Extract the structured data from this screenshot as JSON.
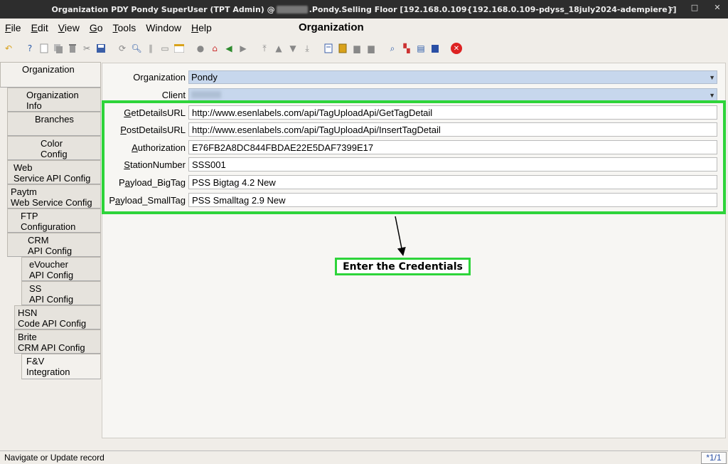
{
  "window": {
    "title_prefix": "Organization  PDY  Pondy  SuperUser (TPT Admin) @ ",
    "title_suffix": ".Pondy.Selling Floor [192.168.0.109{192.168.0.109-pdyss_18july2024-adempiere}]",
    "minimize": "–",
    "maximize": "□",
    "close": "✕"
  },
  "menu": {
    "items": [
      {
        "u": "F",
        "rest": "ile"
      },
      {
        "u": "E",
        "rest": "dit"
      },
      {
        "u": "V",
        "rest": "iew"
      },
      {
        "u": "G",
        "rest": "o"
      },
      {
        "u": "T",
        "rest": "ools"
      },
      {
        "u": "",
        "rest": "Window"
      },
      {
        "u": "H",
        "rest": "elp"
      }
    ],
    "window_title": "Organization"
  },
  "tabs": [
    {
      "line1": "Organization",
      "line2": ""
    },
    {
      "line1": "Organization",
      "line2": "Info"
    },
    {
      "line1": "Branches",
      "line2": ""
    },
    {
      "line1": "Color",
      "line2": "Config"
    },
    {
      "line1": "Web",
      "line2": "Service API Config"
    },
    {
      "line1": "Paytm",
      "line2": "Web Service Config"
    },
    {
      "line1": "FTP",
      "line2": "Configuration"
    },
    {
      "line1": "CRM",
      "line2": "API Config"
    },
    {
      "line1": "eVoucher",
      "line2": "API Config"
    },
    {
      "line1": "SS",
      "line2": "API Config"
    },
    {
      "line1": "HSN",
      "line2": "Code API Config"
    },
    {
      "line1": "Brite",
      "line2": "CRM API Config"
    },
    {
      "line1": "F&V",
      "line2": "Integration"
    }
  ],
  "form": {
    "organization_label": "Organization",
    "organization_value": "Pondy",
    "client_label": "Client",
    "fields": [
      {
        "u": "G",
        "rest": "etDetailsURL",
        "value": "http://www.esenlabels.com/api/TagUploadApi/GetTagDetail"
      },
      {
        "u": "P",
        "rest": "ostDetailsURL",
        "value": "http://www.esenlabels.com/api/TagUploadApi/InsertTagDetail"
      },
      {
        "u": "A",
        "rest": "uthorization",
        "value": "E76FB2A8DC844FBDAE22E5DAF7399E17"
      },
      {
        "u": "S",
        "rest": "tationNumber",
        "value": "SSS001"
      },
      {
        "pre": "P",
        "u": "a",
        "rest": "yload_BigTag",
        "value": "PSS Bigtag 4.2 New"
      },
      {
        "pre": "P",
        "u": "a",
        "rest": "yload_SmallTag",
        "value": "PSS Smalltag 2.9 New"
      }
    ]
  },
  "annotation": {
    "callout": "Enter the Credentials"
  },
  "status": {
    "message": "Navigate or Update record",
    "record": "*1/1"
  },
  "colors": {
    "highlight": "#2ed43a",
    "combo": "#c7d7ed"
  }
}
